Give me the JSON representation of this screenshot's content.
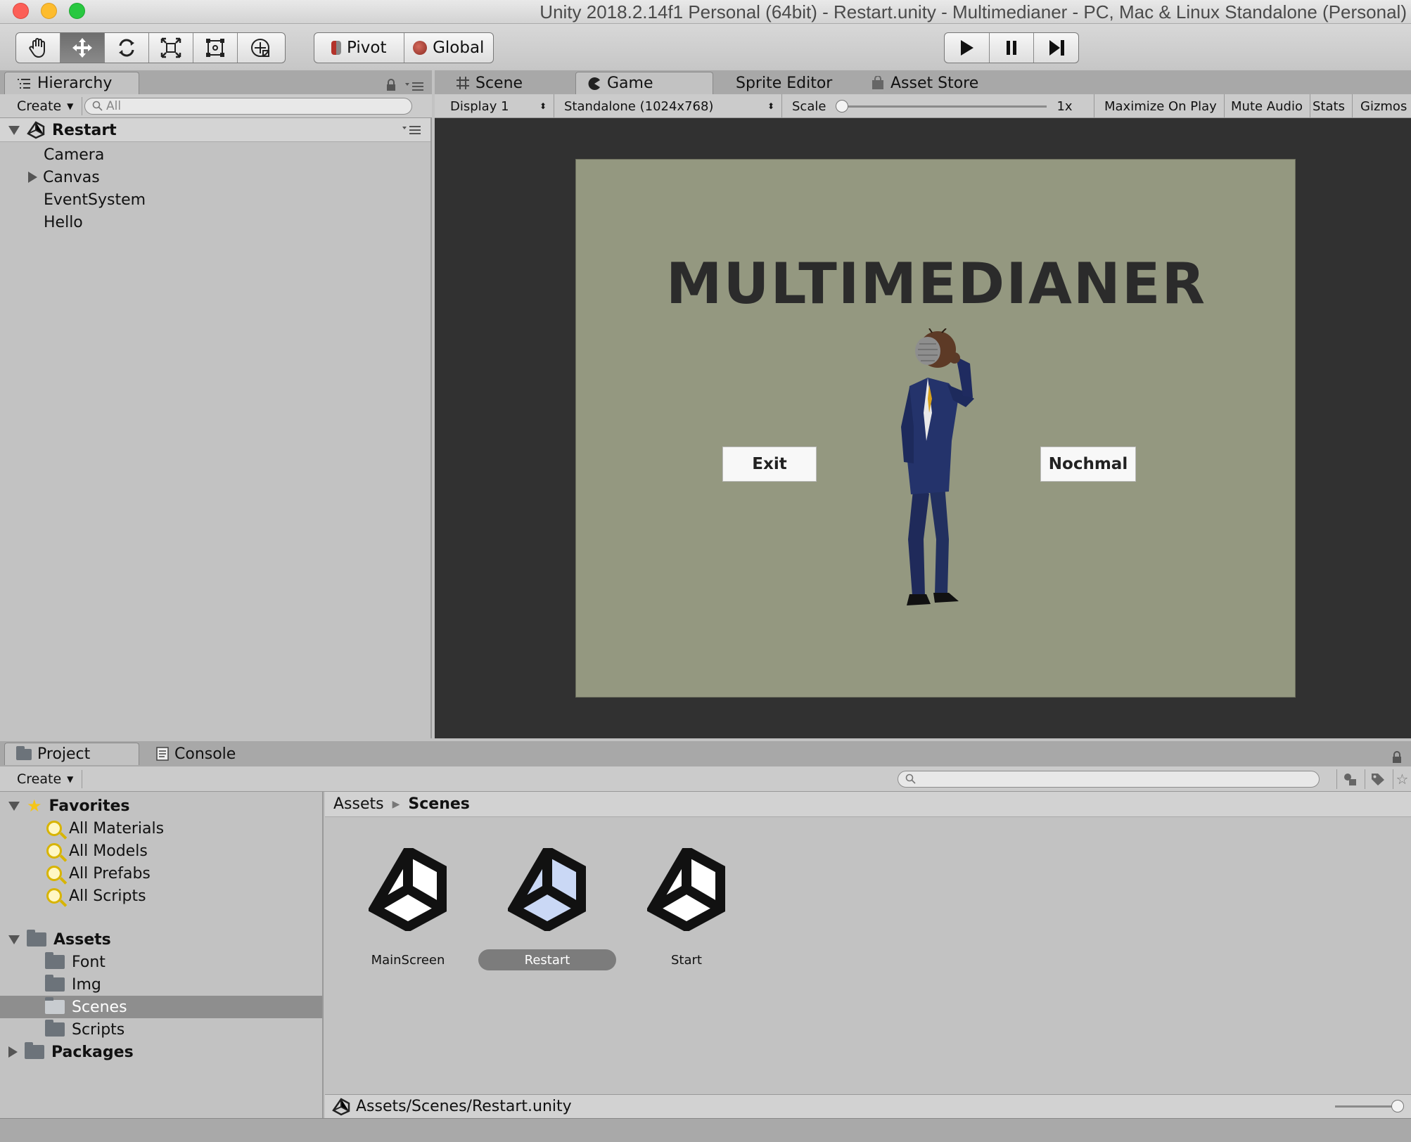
{
  "window": {
    "title": "Unity 2018.2.14f1 Personal (64bit) - Restart.unity - Multimedianer - PC, Mac & Linux Standalone (Personal)"
  },
  "toolbar": {
    "tools": [
      "hand-icon",
      "move-icon",
      "rotate-icon",
      "scale-icon",
      "rect-icon",
      "transform-icon"
    ],
    "active_tool": "move-icon",
    "pivot_label": "Pivot",
    "global_label": "Global",
    "play_controls": [
      "play-icon",
      "pause-icon",
      "step-icon"
    ]
  },
  "hierarchy": {
    "tab_label": "Hierarchy",
    "create_label": "Create",
    "search_placeholder": "All",
    "root": "Restart",
    "items": [
      {
        "label": "Camera",
        "expandable": false
      },
      {
        "label": "Canvas",
        "expandable": true
      },
      {
        "label": "EventSystem",
        "expandable": false
      },
      {
        "label": "Hello",
        "expandable": false
      }
    ]
  },
  "center_tabs": {
    "scene": "Scene",
    "game": "Game",
    "sprite_editor": "Sprite Editor",
    "asset_store": "Asset Store"
  },
  "game_toolbar": {
    "display": "Display 1",
    "resolution": "Standalone (1024x768)",
    "scale_label": "Scale",
    "scale_value": "1x",
    "maximize": "Maximize On Play",
    "mute": "Mute Audio",
    "stats": "Stats",
    "gizmos": "Gizmos"
  },
  "game_view": {
    "title": "MULTIMEDIANER",
    "exit_button": "Exit",
    "again_button": "Nochmal",
    "background_color": "#949880"
  },
  "project": {
    "tab_label": "Project",
    "console_label": "Console",
    "create_label": "Create",
    "favorites": {
      "label": "Favorites",
      "items": [
        "All Materials",
        "All Models",
        "All Prefabs",
        "All Scripts"
      ]
    },
    "assets": {
      "label": "Assets",
      "items": [
        "Font",
        "Img",
        "Scenes",
        "Scripts"
      ],
      "selected": "Scenes"
    },
    "packages_label": "Packages",
    "breadcrumb": [
      "Assets",
      "Scenes"
    ],
    "scene_files": [
      {
        "name": "MainScreen",
        "selected": false
      },
      {
        "name": "Restart",
        "selected": true
      },
      {
        "name": "Start",
        "selected": false
      }
    ],
    "path": "Assets/Scenes/Restart.unity"
  }
}
